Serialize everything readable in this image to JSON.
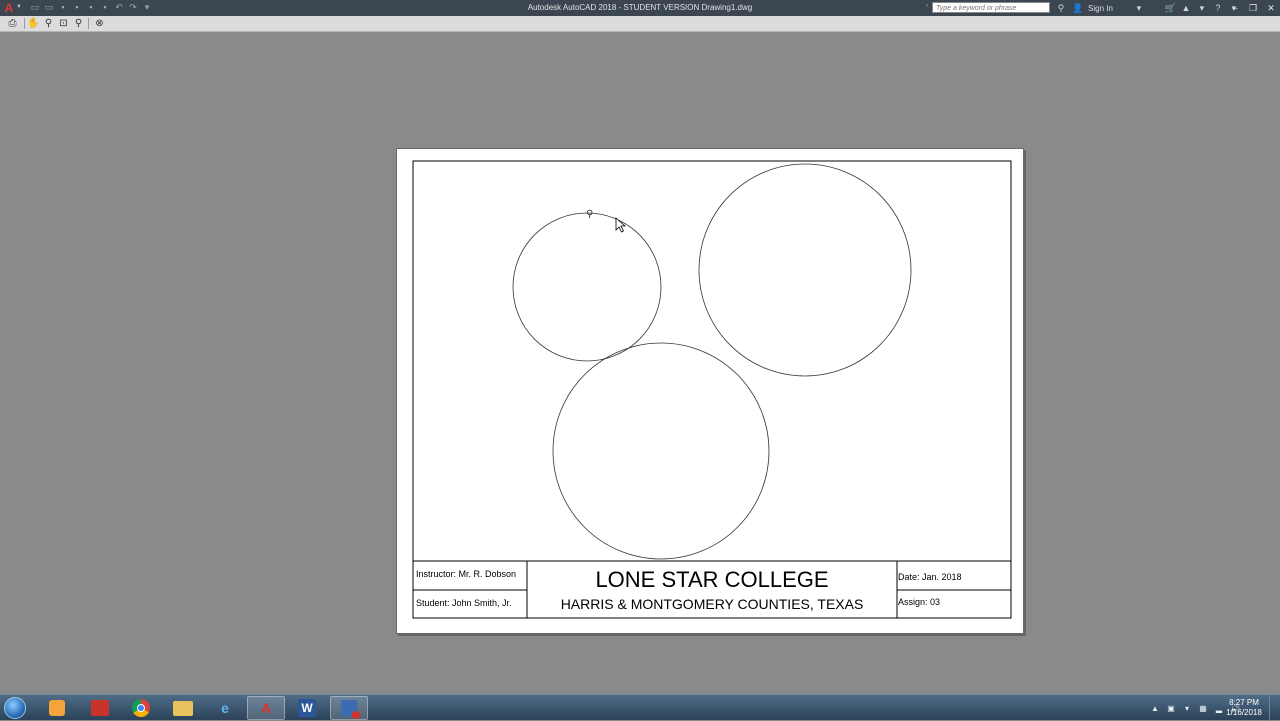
{
  "titlebar": {
    "logo": "A",
    "title": "Autodesk AutoCAD 2018 - STUDENT VERSION    Drawing1.dwg",
    "search_placeholder": "Type a keyword or phrase",
    "sign_in": "Sign In"
  },
  "preview_toolbar": {
    "tools": [
      "print-icon",
      "pan-icon",
      "zoom-realtime-icon",
      "zoom-window-icon",
      "zoom-original-icon",
      "close-preview-icon"
    ]
  },
  "title_block": {
    "instructor": "Instructor:  Mr. R. Dobson",
    "student": "Student:  John Smith, Jr.",
    "college": "LONE STAR COLLEGE",
    "counties": "HARRIS & MONTGOMERY COUNTIES, TEXAS",
    "date": "Date:  Jan. 2018",
    "assign": "Assign:   03"
  },
  "taskbar": {
    "apps": [
      "windows-start",
      "media-player",
      "autodesk-app",
      "chrome",
      "file-explorer",
      "internet-explorer",
      "autocad",
      "word",
      "save-utility"
    ],
    "clock_time": "8:27 PM",
    "clock_date": "1/16/2018"
  },
  "colors": {
    "workspace": "#8a8a8a",
    "titlebar": "#3c4650",
    "paper": "#ffffff",
    "autocad_red": "#e03a2e"
  }
}
